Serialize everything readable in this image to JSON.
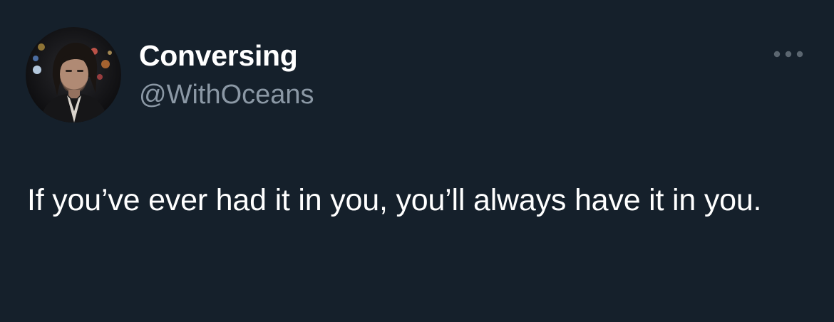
{
  "theme": {
    "background": "#15202b",
    "text_primary": "#ffffff",
    "text_secondary": "#8b98a5",
    "icon_color": "#5b6670"
  },
  "author": {
    "display_name": "Conversing",
    "handle": "@WithOceans",
    "avatar_icon": "profile-photo"
  },
  "more_menu": {
    "icon": "more-horizontal-icon"
  },
  "tweet": {
    "text": "If you’ve ever had it in you, you’ll always have it in you."
  }
}
